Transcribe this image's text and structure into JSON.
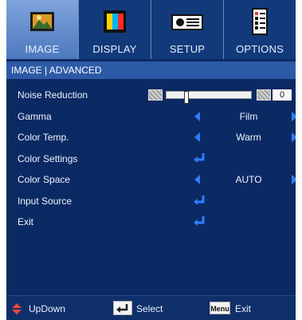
{
  "tabs": [
    {
      "label": "IMAGE",
      "icon": "image-icon",
      "active": true
    },
    {
      "label": "DISPLAY",
      "icon": "display-icon",
      "active": false
    },
    {
      "label": "SETUP",
      "icon": "setup-icon",
      "active": false
    },
    {
      "label": "OPTIONS",
      "icon": "options-icon",
      "active": false
    }
  ],
  "breadcrumb": "IMAGE | ADVANCED",
  "items": {
    "noise": {
      "label": "Noise Reduction",
      "value": "0"
    },
    "gamma": {
      "label": "Gamma",
      "value": "Film"
    },
    "color_temp": {
      "label": "Color Temp.",
      "value": "Warm"
    },
    "color_settings": {
      "label": "Color Settings"
    },
    "color_space": {
      "label": "Color Space",
      "value": "AUTO"
    },
    "input_source": {
      "label": "Input Source"
    },
    "exit": {
      "label": "Exit"
    }
  },
  "footer": {
    "updown": "UpDown",
    "select": "Select",
    "menu_key": "Menu",
    "exit": "Exit"
  },
  "colors": {
    "osd_bg": "#0b2a63",
    "tab_active": "#5a86c9",
    "accent_arrow": "#2f7dff"
  }
}
